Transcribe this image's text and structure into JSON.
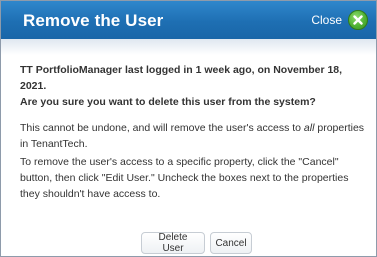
{
  "dialog": {
    "title": "Remove the User",
    "close_label": "Close"
  },
  "content": {
    "last_login": "TT PortfolioManager last logged in 1 week ago, on November 18, 2021.",
    "confirm_question": "Are you sure you want to delete this user from the system?",
    "warning_before": "This cannot be undone, and will remove the user's access to ",
    "warning_emphasis": "all",
    "warning_after": " properties in TenantTech.",
    "instructions": "To remove the user's access to a specific property, click the \"Cancel\" button, then click \"Edit User.\" Uncheck the boxes next to the properties they shouldn't have access to."
  },
  "buttons": {
    "delete_label": "Delete User",
    "cancel_label": "Cancel"
  },
  "colors": {
    "titlebar": "#1e6fb3",
    "close_icon": "#4fb233"
  }
}
